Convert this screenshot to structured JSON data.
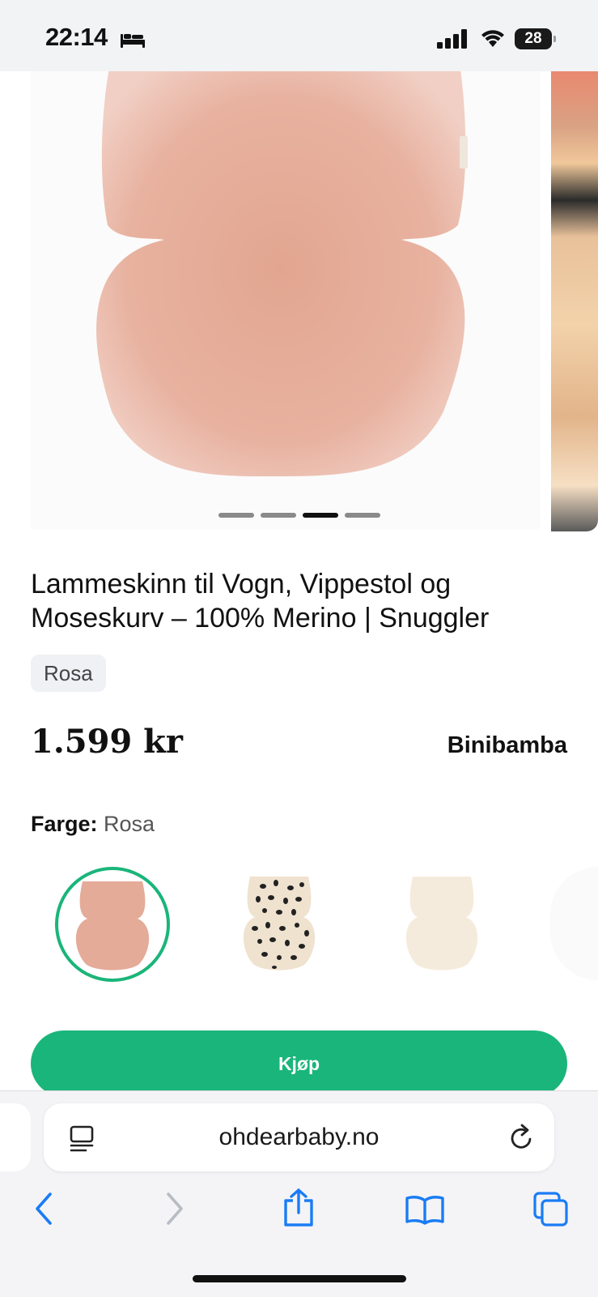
{
  "status_bar": {
    "time": "22:14",
    "battery": "28",
    "icons": [
      "bed-icon",
      "cellular-signal-icon",
      "wifi-icon",
      "battery-icon"
    ]
  },
  "gallery": {
    "image_count": 4,
    "active_index": 3
  },
  "product": {
    "title": "Lammeskinn til Vogn, Vippestol og Moseskurv – 100% Merino | Snuggler",
    "variant_chip": "Rosa",
    "price": "1.599 kr",
    "brand": "Binibamba",
    "color_label": "Farge:",
    "color_value": "Rosa",
    "swatches": [
      "rosa",
      "leopard-spots",
      "cream"
    ],
    "buy_label": "Kjøp"
  },
  "browser": {
    "url": "ohdearbaby.no",
    "icons": [
      "reader-icon",
      "reload-icon",
      "back-icon",
      "forward-icon",
      "share-icon",
      "bookmarks-icon",
      "tabs-icon"
    ]
  },
  "colors": {
    "accent": "#1ab57a",
    "ios_blue": "#1a7cf5",
    "status_bg": "#f2f3f5"
  }
}
